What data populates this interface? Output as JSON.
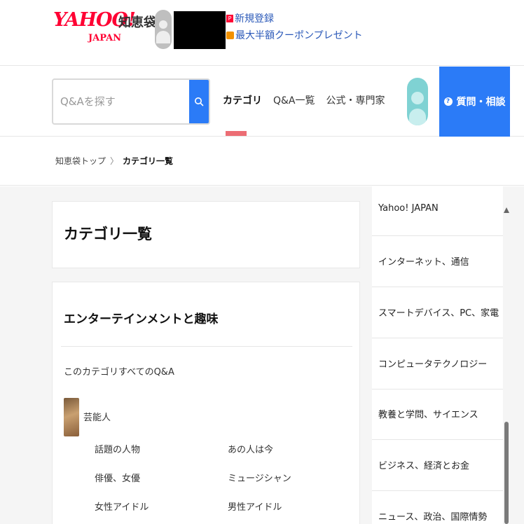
{
  "header": {
    "logo_yahoo": "YAHOO!",
    "logo_japan": "JAPAN",
    "logo_service": "知恵袋",
    "links": [
      {
        "label": "新規登録",
        "icon": "paypay-p-icon"
      },
      {
        "label": "最大半額クーポンプレゼント",
        "icon": "cart-icon"
      }
    ]
  },
  "nav": {
    "search_placeholder": "Q&Aを探す",
    "tabs": [
      {
        "label": "カテゴリ",
        "active": true
      },
      {
        "label": "Q&A一覧",
        "active": false
      },
      {
        "label": "公式・専門家",
        "active": false
      }
    ],
    "ask_button": "質問・相談",
    "accent_color": "#2b7bf7",
    "indicator_color": "#ec6d74"
  },
  "breadcrumb": {
    "home": "知恵袋トップ",
    "separator": "〉",
    "current": "カテゴリ一覧"
  },
  "main": {
    "page_title": "カテゴリ一覧",
    "category": {
      "title": "エンターテインメントと趣味",
      "all_link": "このカテゴリすべてのQ&A",
      "subcategory": {
        "title": "芸能人",
        "items": [
          "話題の人物",
          "あの人は今",
          "俳優、女優",
          "ミュージシャン",
          "女性アイドル",
          "男性アイドル"
        ]
      }
    }
  },
  "sidebar": {
    "items": [
      "Yahoo! JAPAN",
      "インターネット、通信",
      "スマートデバイス、PC、家電",
      "コンピュータテクノロジー",
      "教養と学問、サイエンス",
      "ビジネス、経済とお金",
      "ニュース、政治、国際情勢"
    ]
  }
}
